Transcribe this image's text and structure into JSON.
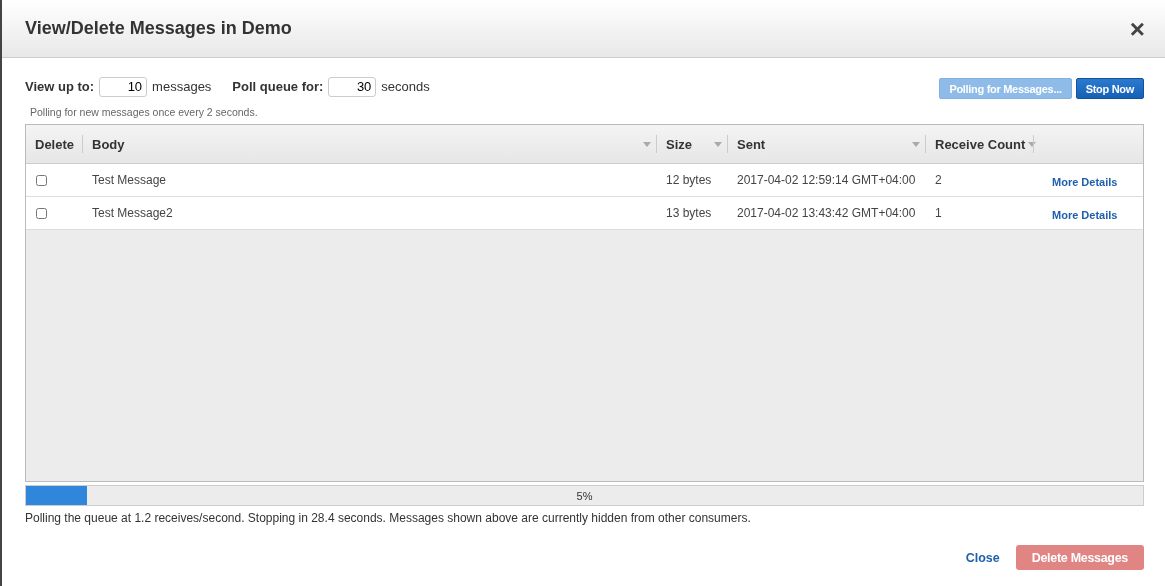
{
  "dialog": {
    "title": "View/Delete Messages in Demo",
    "close": "×"
  },
  "options": {
    "view_label": "View up to:",
    "view_value": "10",
    "view_unit": "messages",
    "poll_label": "Poll queue for:",
    "poll_value": "30",
    "poll_unit": "seconds",
    "note": "Polling for new messages once every 2 seconds."
  },
  "actions": [
    {
      "label": "Polling for Messages...",
      "kind": "secondary",
      "disabled": true
    },
    {
      "label": "Stop Now",
      "kind": "primary",
      "disabled": false
    }
  ],
  "table": {
    "columns": [
      {
        "label": "Delete",
        "sortable": false
      },
      {
        "label": "Body",
        "sortable": true
      },
      {
        "label": "Size",
        "sortable": true
      },
      {
        "label": "Sent",
        "sortable": true
      },
      {
        "label": "Receive Count",
        "sortable": true
      }
    ],
    "rows": [
      {
        "checked": false,
        "body": "Test Message",
        "size": "12 bytes",
        "sent": "2017-04-02 12:59:14 GMT+04:00",
        "receive_count": "2",
        "link": "More Details"
      },
      {
        "checked": false,
        "body": "Test Message2",
        "size": "13 bytes",
        "sent": "2017-04-02 13:43:42 GMT+04:00",
        "receive_count": "1",
        "link": "More Details"
      }
    ]
  },
  "progress": {
    "level": 0.055,
    "label": "5%"
  },
  "status": "Polling the queue at 1.2 receives/second. Stopping in 28.4 seconds. Messages shown above are currently hidden from other consumers.",
  "footer": {
    "close": "Close",
    "delete": {
      "label": "Delete Messages",
      "disabled": true
    }
  }
}
